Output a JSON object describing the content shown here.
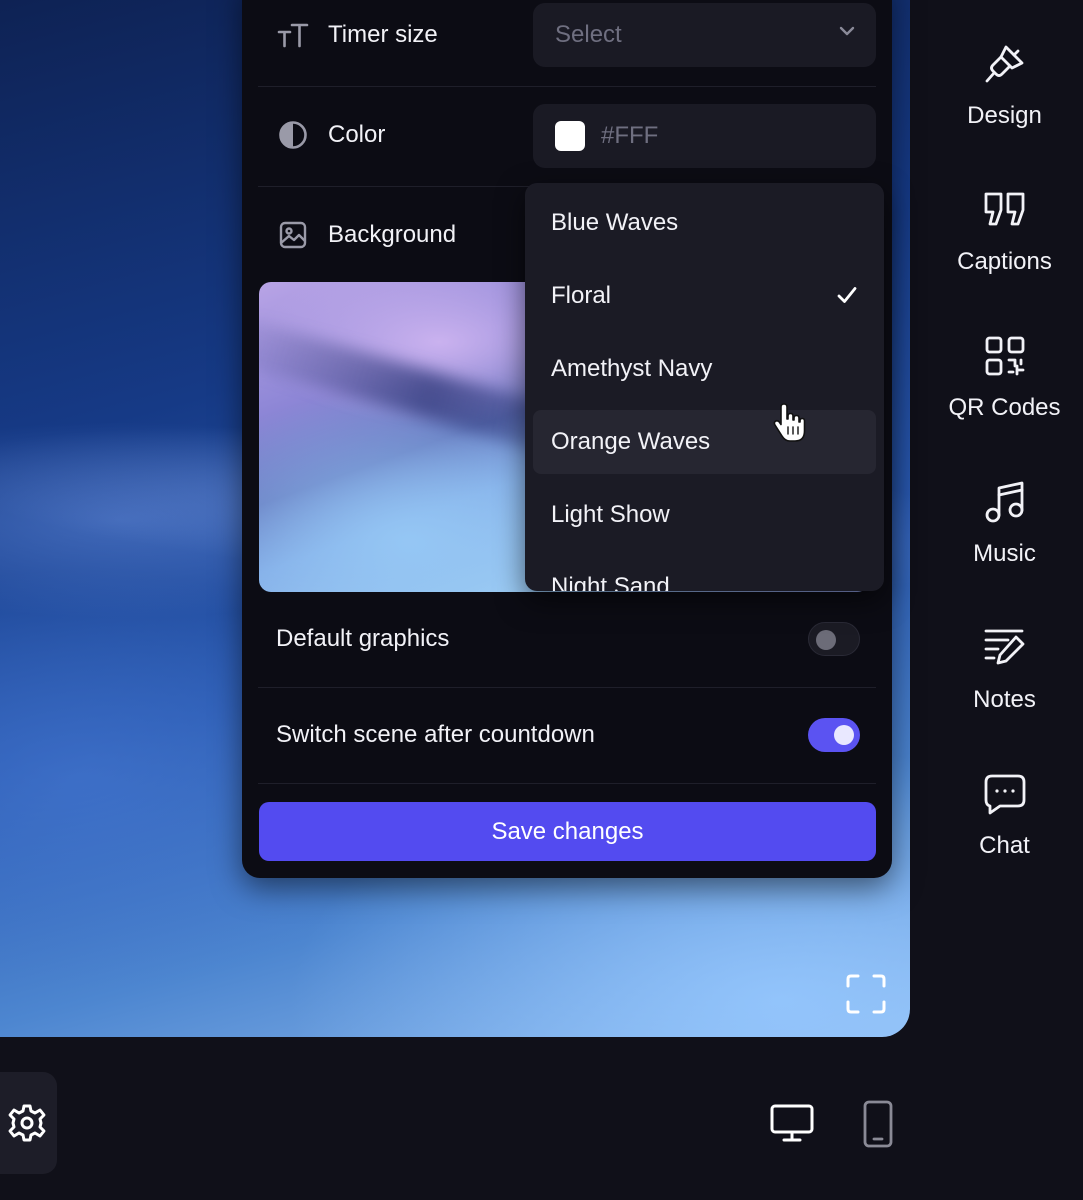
{
  "settings": {
    "timer_size": {
      "label": "Timer size",
      "placeholder": "Select"
    },
    "color": {
      "label": "Color",
      "value": "#FFF",
      "swatch": "#FFFFFF"
    },
    "background": {
      "label": "Background",
      "preview": "gradient-preview-image"
    },
    "default_graphics": {
      "label": "Default graphics",
      "enabled": false
    },
    "switch_scene": {
      "label": "Switch scene after countdown",
      "enabled": true
    },
    "save_label": "Save changes"
  },
  "dropdown": {
    "selected": "Floral",
    "hovered": "Orange Waves",
    "options": [
      "Blue Waves",
      "Floral",
      "Amethyst Navy",
      "Orange Waves",
      "Light Show",
      "Night Sand"
    ]
  },
  "sidebar": {
    "items": [
      {
        "label": "Design",
        "icon": "brush-icon"
      },
      {
        "label": "Captions",
        "icon": "quote-icon"
      },
      {
        "label": "QR Codes",
        "icon": "qr-code-icon"
      },
      {
        "label": "Music",
        "icon": "music-note-icon"
      },
      {
        "label": "Notes",
        "icon": "notes-icon"
      },
      {
        "label": "Chat",
        "icon": "chat-icon"
      }
    ]
  },
  "bottom_bar": {
    "icons": [
      "gear-icon",
      "desktop-icon",
      "mobile-icon"
    ]
  },
  "colors": {
    "accent": "#534BF0",
    "panel": "#0C0C14",
    "field": "#1A1A24",
    "app_background": "#101019"
  }
}
